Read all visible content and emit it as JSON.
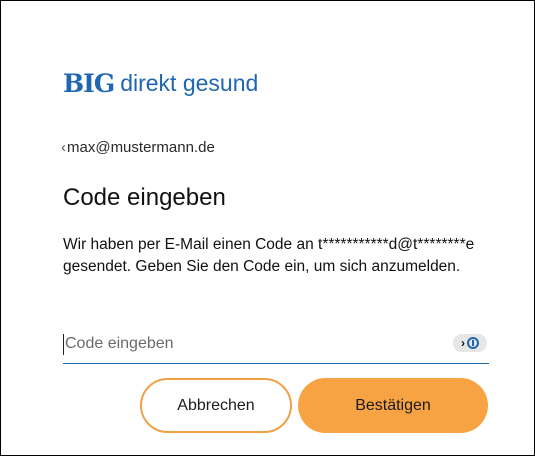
{
  "logo": {
    "mark": "BIG",
    "text": "direkt gesund",
    "brand_color": "#1f67b1"
  },
  "identity": {
    "caret": "‹",
    "email": "max@mustermann.de"
  },
  "heading": "Code eingeben",
  "description": "Wir haben per E-Mail einen Code an t***********d@t********e gesendet. Geben Sie den Code ein, um sich anzumelden.",
  "code_input": {
    "placeholder": "Code eingeben",
    "value": ""
  },
  "password_manager_badge": {
    "icon": "password-manager-icon",
    "chevron": "›"
  },
  "buttons": {
    "cancel_label": "Abbrechen",
    "confirm_label": "Bestätigen",
    "accent_color": "#f7a343"
  }
}
